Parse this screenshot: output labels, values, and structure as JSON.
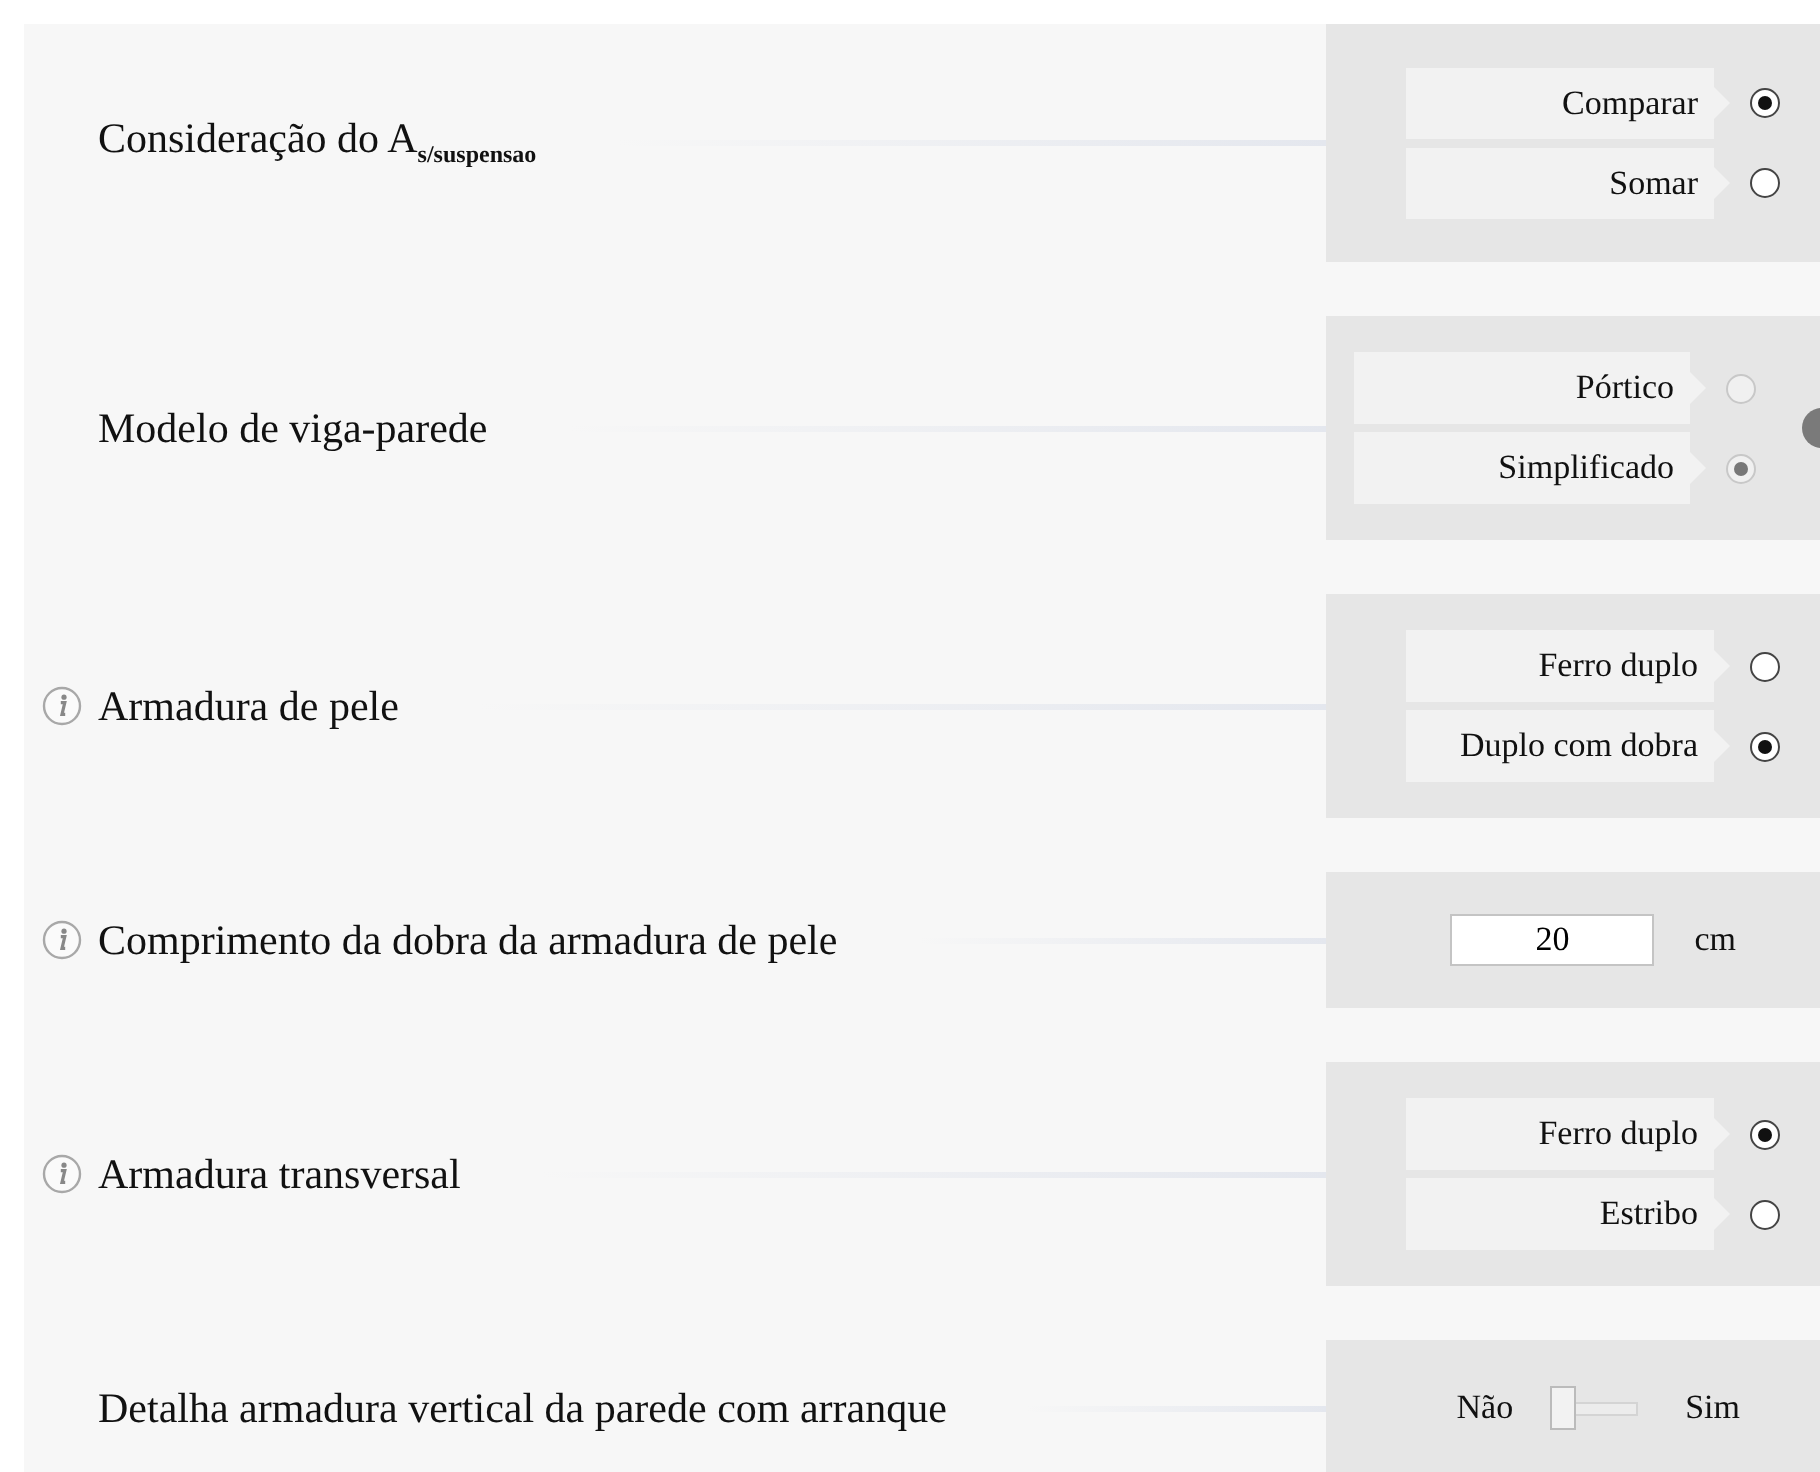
{
  "settings": [
    {
      "kind": "radio",
      "label": "Consideração do A$_{s/suspensao}$",
      "info": false,
      "disabled": false,
      "options": [
        {
          "label": "Comparar",
          "selected": true
        },
        {
          "label": "Somar",
          "selected": false
        }
      ]
    },
    {
      "kind": "radio",
      "label": "Modelo de viga-parede",
      "info": false,
      "disabled": true,
      "help": true,
      "options": [
        {
          "label": "Pórtico",
          "selected": false
        },
        {
          "label": "Simplificado",
          "selected": true
        }
      ]
    },
    {
      "kind": "radio",
      "label": "Armadura de pele",
      "info": true,
      "disabled": false,
      "options": [
        {
          "label": "Ferro duplo",
          "selected": false
        },
        {
          "label": "Duplo com dobra",
          "selected": true
        }
      ]
    },
    {
      "kind": "input",
      "label": "Comprimento da dobra da armadura de pele",
      "info": true,
      "value": "20",
      "unit": "cm"
    },
    {
      "kind": "radio",
      "label": "Armadura transversal",
      "info": true,
      "disabled": false,
      "options": [
        {
          "label": "Ferro duplo",
          "selected": true
        },
        {
          "label": "Estribo",
          "selected": false
        }
      ]
    },
    {
      "kind": "toggle",
      "label": "Detalha armadura vertical da parede com arranque",
      "info": false,
      "off_label": "Não",
      "on_label": "Sim",
      "on": false
    }
  ]
}
